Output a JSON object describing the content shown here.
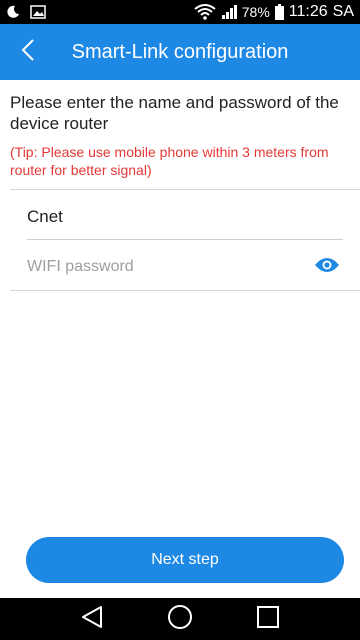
{
  "status_bar": {
    "battery_text": "78%",
    "time": "11:26",
    "time_suffix": "SA",
    "icons": [
      "moon-icon",
      "image-icon",
      "wifi-icon",
      "signal-icon",
      "battery-icon"
    ]
  },
  "app_bar": {
    "title": "Smart-Link configuration",
    "back_icon": "chevron-left-icon",
    "color": "#1e88e5"
  },
  "content": {
    "instruction": "Please enter the name and password of the device router",
    "tip": "(Tip: Please use mobile phone within 3 meters from router for better signal)",
    "tip_color": "#e53935",
    "ssid_value": "Cnet",
    "password_placeholder": "WIFI password",
    "password_value": "",
    "eye_icon": "eye-icon"
  },
  "actions": {
    "next_label": "Next step"
  },
  "nav_bar": {
    "icons": [
      "back-triangle-icon",
      "home-circle-icon",
      "recents-square-icon"
    ]
  }
}
